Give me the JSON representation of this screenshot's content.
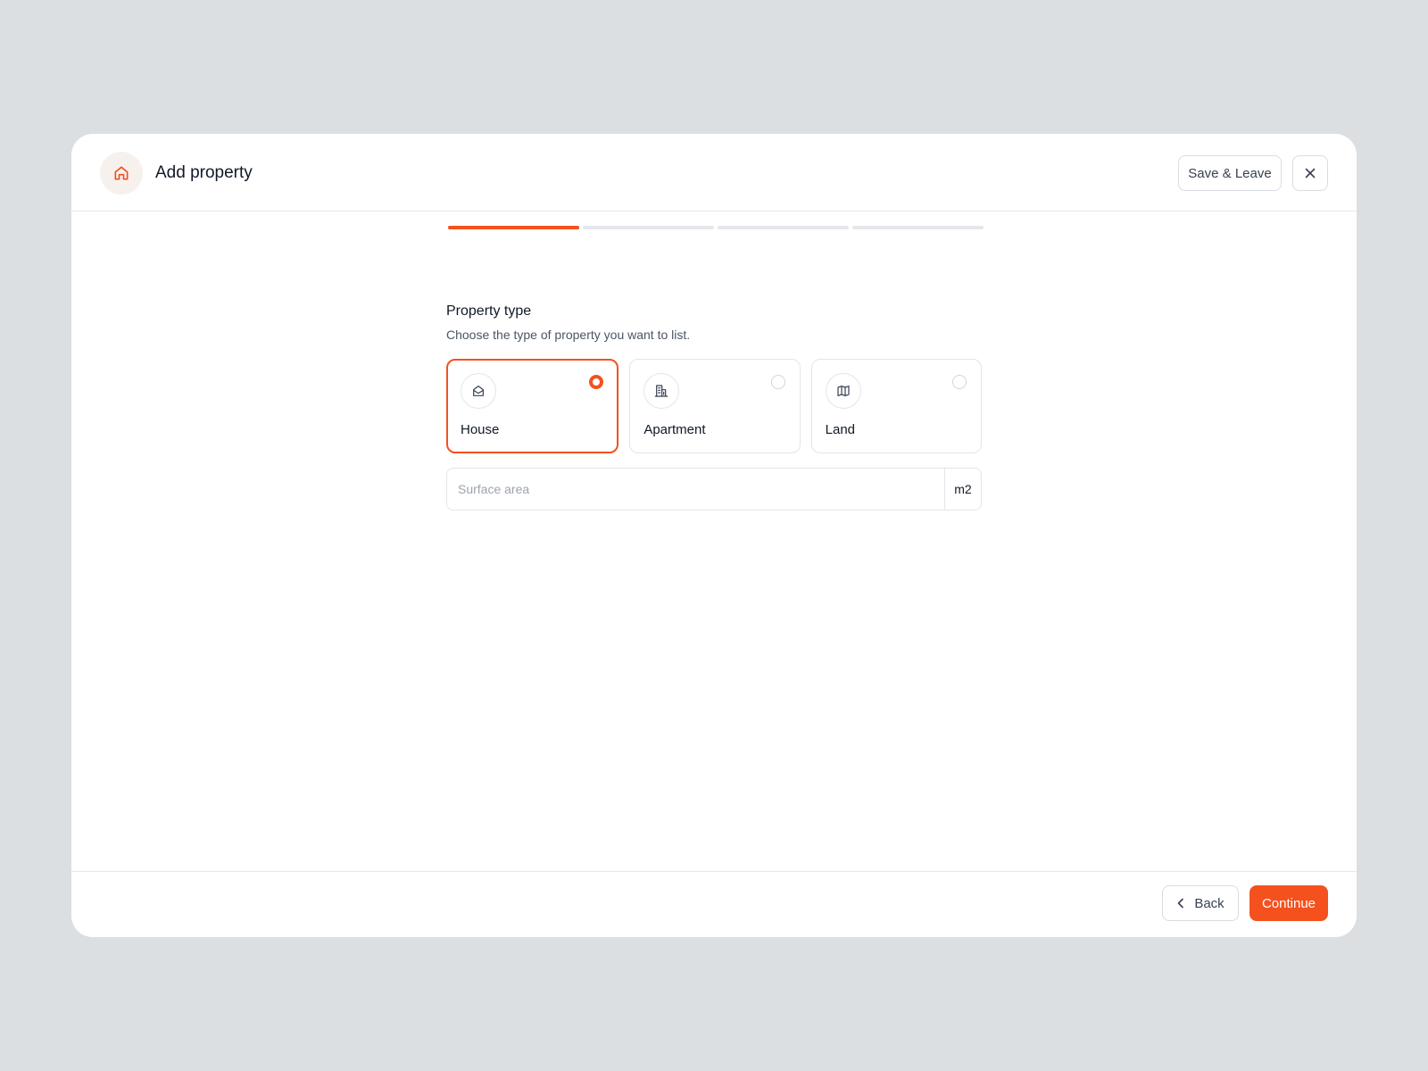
{
  "header": {
    "title": "Add property",
    "logo_icon": "home-icon",
    "save_leave_label": "Save & Leave",
    "close_icon": "close-icon"
  },
  "progress": {
    "total_steps": 4,
    "current_step": 1
  },
  "main": {
    "section_title": "Property type",
    "section_subtitle": "Choose the type of property you want to list.",
    "options": [
      {
        "label": "House",
        "icon": "house-icon",
        "selected": true
      },
      {
        "label": "Apartment",
        "icon": "building-icon",
        "selected": false
      },
      {
        "label": "Land",
        "icon": "map-icon",
        "selected": false
      }
    ],
    "surface": {
      "placeholder": "Surface area",
      "value": "",
      "unit": "m2"
    }
  },
  "footer": {
    "back_label": "Back",
    "back_icon": "chevron-left-icon",
    "continue_label": "Continue"
  },
  "colors": {
    "accent": "#F4511E",
    "background": "#DCDFE2",
    "border": "#E2E5EA"
  }
}
